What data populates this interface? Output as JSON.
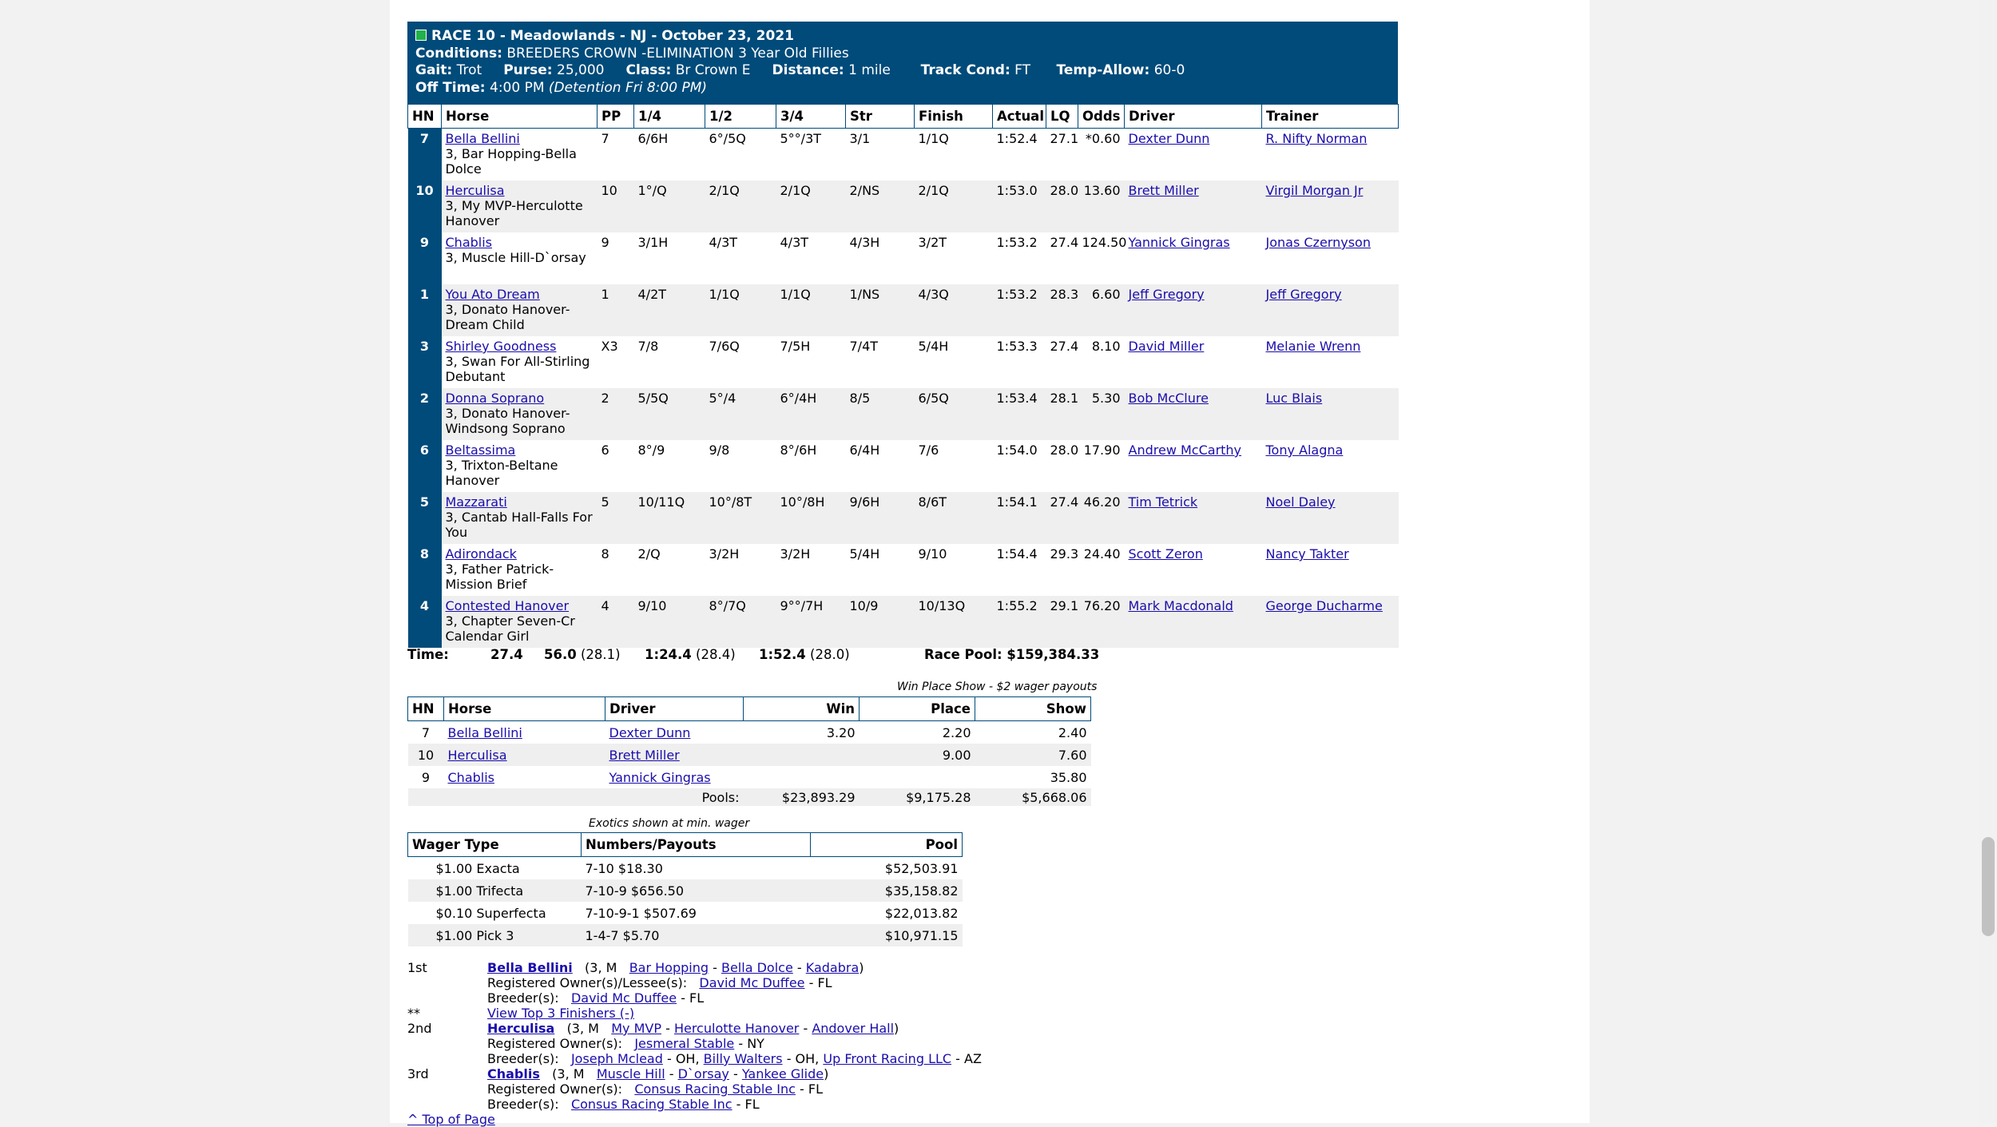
{
  "race": {
    "title": "RACE 10 - Meadowlands - NJ - October 23, 2021",
    "conditions_label": "Conditions:",
    "conditions": "BREEDERS CROWN -ELIMINATION 3 Year Old Fillies",
    "gait_label": "Gait:",
    "gait": "Trot",
    "purse_label": "Purse:",
    "purse": "25,000",
    "class_label": "Class:",
    "class": "Br Crown E",
    "distance_label": "Distance:",
    "distance": "1 mile",
    "track_label": "Track Cond:",
    "track": "FT",
    "temp_label": "Temp-Allow:",
    "temp": "60-0",
    "off_label": "Off Time:",
    "off": "4:00 PM",
    "detention": "(Detention Fri 8:00 PM)"
  },
  "results": {
    "headers": [
      "HN",
      "Horse",
      "PP",
      "1/4",
      "1/2",
      "3/4",
      "Str",
      "Finish",
      "Actual",
      "LQ",
      "Odds",
      "Driver",
      "Trainer"
    ],
    "rows": [
      {
        "hn": "7",
        "horse": "Bella Bellini",
        "desc": "3, Bar Hopping-Bella Dolce",
        "pp": "7",
        "q1": "6/6H",
        "q2": "6°/5Q",
        "q3": "5°°/3T",
        "str": "3/1",
        "fin": "1/1Q",
        "act": "1:52.4",
        "lq": "27.1",
        "odds": "*0.60",
        "driver": "Dexter Dunn",
        "trainer": "R. Nifty Norman"
      },
      {
        "hn": "10",
        "horse": "Herculisa",
        "desc": "3, My MVP-Herculotte Hanover",
        "pp": "10",
        "q1": "1°/Q",
        "q2": "2/1Q",
        "q3": "2/1Q",
        "str": "2/NS",
        "fin": "2/1Q",
        "act": "1:53.0",
        "lq": "28.0",
        "odds": "13.60",
        "driver": "Brett Miller",
        "trainer": "Virgil Morgan Jr"
      },
      {
        "hn": "9",
        "horse": "Chablis",
        "desc": "3, Muscle Hill-D`orsay",
        "pp": "9",
        "q1": "3/1H",
        "q2": "4/3T",
        "q3": "4/3T",
        "str": "4/3H",
        "fin": "3/2T",
        "act": "1:53.2",
        "lq": "27.4",
        "odds": "124.50",
        "driver": "Yannick Gingras",
        "trainer": "Jonas Czernyson"
      },
      {
        "hn": "1",
        "horse": "You Ato Dream",
        "desc": "3, Donato Hanover-Dream Child",
        "pp": "1",
        "q1": "4/2T",
        "q2": "1/1Q",
        "q3": "1/1Q",
        "str": "1/NS",
        "fin": "4/3Q",
        "act": "1:53.2",
        "lq": "28.3",
        "odds": "6.60",
        "driver": "Jeff Gregory",
        "trainer": "Jeff Gregory"
      },
      {
        "hn": "3",
        "horse": "Shirley Goodness",
        "desc": "3, Swan For All-Stirling Debutant",
        "pp": "X3",
        "q1": "7/8",
        "q2": "7/6Q",
        "q3": "7/5H",
        "str": "7/4T",
        "fin": "5/4H",
        "act": "1:53.3",
        "lq": "27.4",
        "odds": "8.10",
        "driver": "David Miller",
        "trainer": "Melanie Wrenn"
      },
      {
        "hn": "2",
        "horse": "Donna Soprano",
        "desc": "3, Donato Hanover-Windsong Soprano",
        "pp": "2",
        "q1": "5/5Q",
        "q2": "5°/4",
        "q3": "6°/4H",
        "str": "8/5",
        "fin": "6/5Q",
        "act": "1:53.4",
        "lq": "28.1",
        "odds": "5.30",
        "driver": "Bob McClure",
        "trainer": "Luc Blais"
      },
      {
        "hn": "6",
        "horse": "Beltassima",
        "desc": "3, Trixton-Beltane Hanover",
        "pp": "6",
        "q1": "8°/9",
        "q2": "9/8",
        "q3": "8°/6H",
        "str": "6/4H",
        "fin": "7/6",
        "act": "1:54.0",
        "lq": "28.0",
        "odds": "17.90",
        "driver": "Andrew McCarthy",
        "trainer": "Tony Alagna"
      },
      {
        "hn": "5",
        "horse": "Mazzarati",
        "desc": "3, Cantab Hall-Falls For You",
        "pp": "5",
        "q1": "10/11Q",
        "q2": "10°/8T",
        "q3": "10°/8H",
        "str": "9/6H",
        "fin": "8/6T",
        "act": "1:54.1",
        "lq": "27.4",
        "odds": "46.20",
        "driver": "Tim Tetrick",
        "trainer": "Noel Daley"
      },
      {
        "hn": "8",
        "horse": "Adirondack",
        "desc": "3, Father Patrick-Mission Brief",
        "pp": "8",
        "q1": "2/Q",
        "q2": "3/2H",
        "q3": "3/2H",
        "str": "5/4H",
        "fin": "9/10",
        "act": "1:54.4",
        "lq": "29.3",
        "odds": "24.40",
        "driver": "Scott Zeron",
        "trainer": "Nancy Takter"
      },
      {
        "hn": "4",
        "horse": "Contested Hanover",
        "desc": "3, Chapter Seven-Cr Calendar Girl",
        "pp": "4",
        "q1": "9/10",
        "q2": "8°/7Q",
        "q3": "9°°/7H",
        "str": "10/9",
        "fin": "10/13Q",
        "act": "1:55.2",
        "lq": "29.1",
        "odds": "76.20",
        "driver": "Mark Macdonald",
        "trainer": "George Ducharme"
      }
    ]
  },
  "times": {
    "label": "Time:",
    "q1": "27.4",
    "q2": "56.0",
    "q2_split": "(28.1)",
    "q3": "1:24.4",
    "q3_split": "(28.4)",
    "fin": "1:52.4",
    "fin_split": "(28.0)",
    "pool": "Race Pool: $159,384.33"
  },
  "wps": {
    "caption": "Win Place Show - $2 wager payouts",
    "headers": [
      "HN",
      "Horse",
      "Driver",
      "Win",
      "Place",
      "Show"
    ],
    "rows": [
      {
        "hn": "7",
        "horse": "Bella Bellini",
        "driver": "Dexter Dunn",
        "win": "3.20",
        "place": "2.20",
        "show": "2.40"
      },
      {
        "hn": "10",
        "horse": "Herculisa",
        "driver": "Brett Miller",
        "win": "",
        "place": "9.00",
        "show": "7.60"
      },
      {
        "hn": "9",
        "horse": "Chablis",
        "driver": "Yannick Gingras",
        "win": "",
        "place": "",
        "show": "35.80"
      }
    ],
    "pools_label": "Pools:",
    "pool_win": "$23,893.29",
    "pool_place": "$9,175.28",
    "pool_show": "$5,668.06"
  },
  "exotics": {
    "caption": "Exotics shown at min. wager",
    "headers": [
      "Wager Type",
      "Numbers/Payouts",
      "Pool"
    ],
    "rows": [
      {
        "type": "$1.00 Exacta",
        "payout": "7-10 $18.30",
        "pool": "$52,503.91"
      },
      {
        "type": "$1.00 Trifecta",
        "payout": "7-10-9 $656.50",
        "pool": "$35,158.82"
      },
      {
        "type": "$0.10 Superfecta",
        "payout": "7-10-9-1 $507.69",
        "pool": "$22,013.82"
      },
      {
        "type": "$1.00 Pick 3",
        "payout": "1-4-7 $5.70",
        "pool": "$10,971.15"
      }
    ]
  },
  "finishers": {
    "first": {
      "place": "1st",
      "horse": "Bella Bellini",
      "info": "(3, M",
      "sire": "Bar Hopping",
      "dam": "Bella Dolce",
      "damsire": "Kadabra",
      "owner_label": "Registered Owner(s)/Lessee(s):",
      "owner": "David Mc Duffee",
      "owner_st": "- FL",
      "breeder_label": "Breeder(s):",
      "breeder": "David Mc Duffee",
      "breeder_st": "- FL"
    },
    "top3_mark": "**",
    "top3_link": "View Top 3 Finishers (-)",
    "second": {
      "place": "2nd",
      "horse": "Herculisa",
      "info": "(3, M",
      "sire": "My MVP",
      "dam": "Herculotte Hanover",
      "damsire": "Andover Hall",
      "owner_label": "Registered Owner(s):",
      "owner": "Jesmeral Stable",
      "owner_st": "- NY",
      "breeder_label": "Breeder(s):",
      "breeder1": "Joseph Mclead",
      "b1_st": "- OH,",
      "breeder2": "Billy Walters",
      "b2_st": "- OH,",
      "breeder3": "Up Front Racing LLC",
      "b3_st": "- AZ"
    },
    "third": {
      "place": "3rd",
      "horse": "Chablis",
      "info": "(3, M",
      "sire": "Muscle Hill",
      "dam": "D`orsay",
      "damsire": "Yankee Glide",
      "owner_label": "Registered Owner(s):",
      "owner": "Consus Racing Stable Inc",
      "owner_st": "- FL",
      "breeder_label": "Breeder(s):",
      "breeder": "Consus Racing Stable Inc",
      "breeder_st": "- FL"
    },
    "top_link": "^ Top of Page"
  }
}
